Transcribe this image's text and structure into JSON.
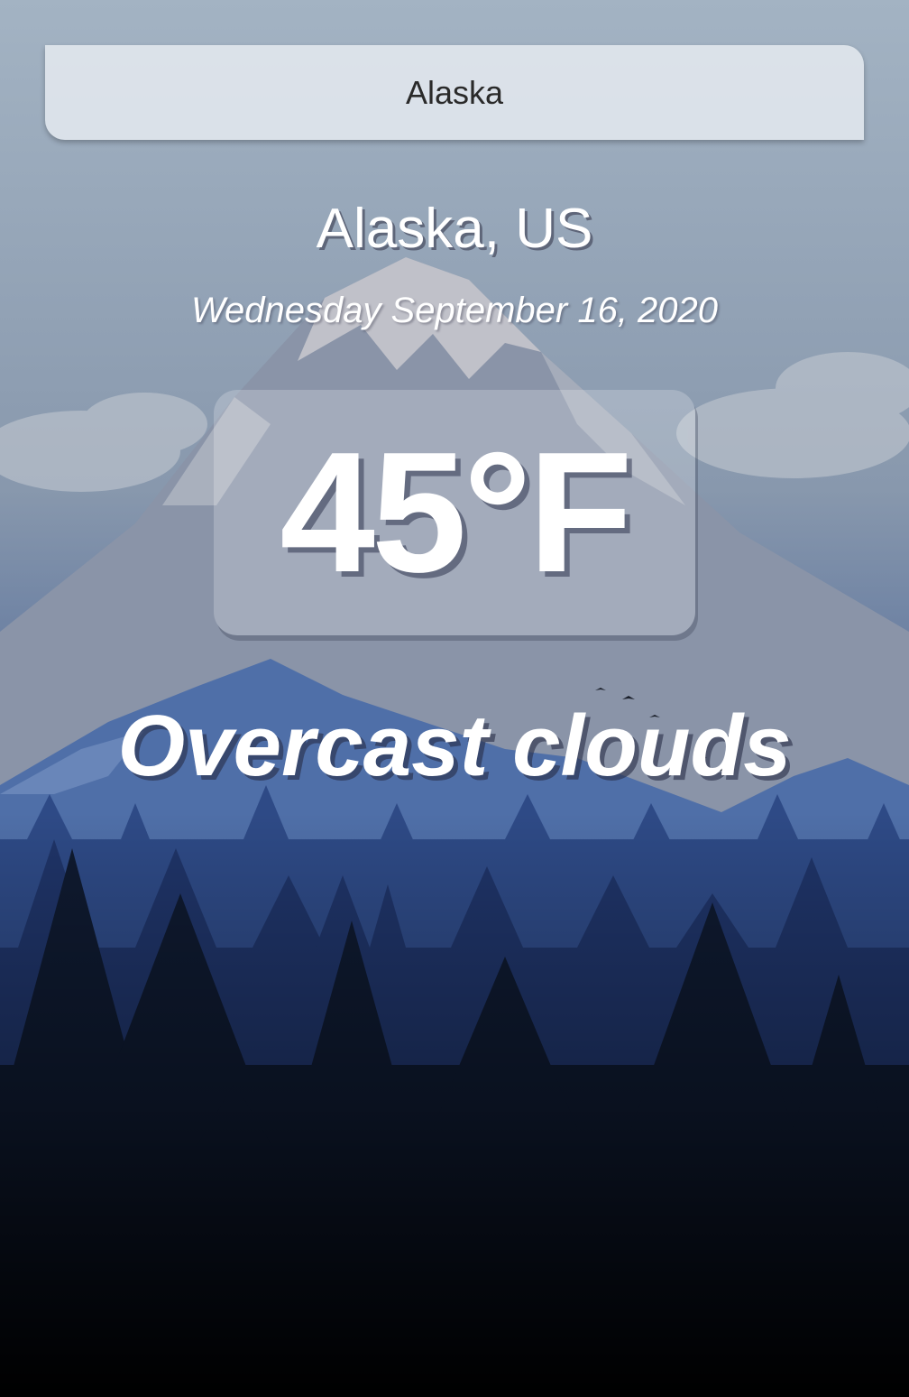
{
  "search": {
    "value": "Alaska"
  },
  "weather": {
    "location": "Alaska, US",
    "date": "Wednesday September 16, 2020",
    "temperature": "45°F",
    "condition": "Overcast clouds"
  },
  "theme": {
    "text_color": "#ffffff",
    "panel_color": "#eceff5",
    "sky_top": "#9fb0c0",
    "forest_bottom": "#050608"
  }
}
